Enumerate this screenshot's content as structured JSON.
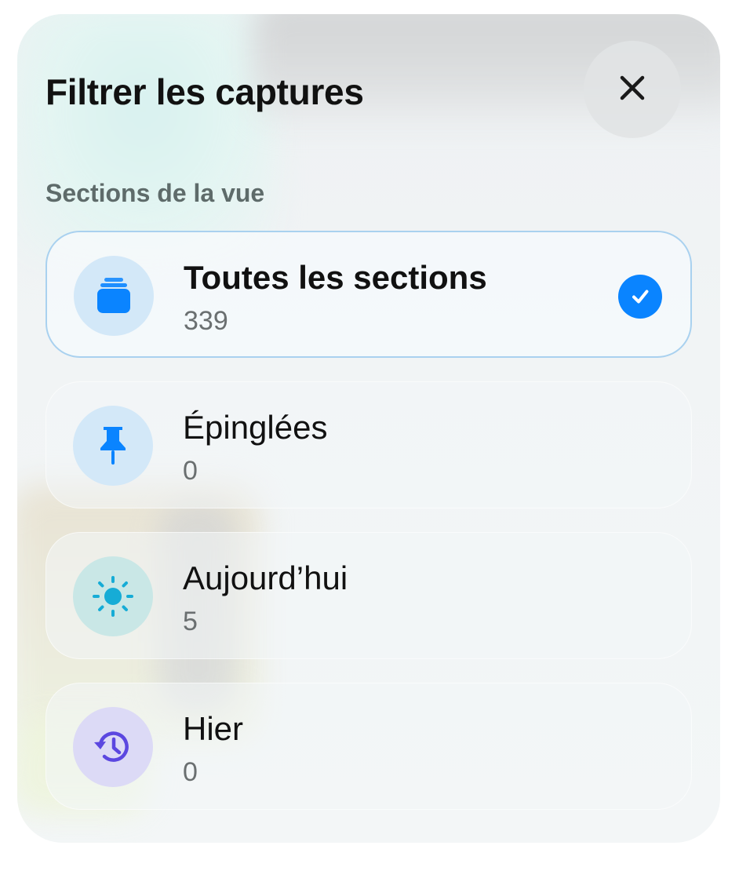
{
  "header": {
    "title": "Filtrer les captures",
    "close_icon": "close-icon"
  },
  "section_heading": "Sections de la vue",
  "items": [
    {
      "label": "Toutes les sections",
      "count": "339",
      "icon": "stack-icon",
      "selected": true,
      "icon_bg": "#d3e8f8",
      "icon_color": "#0a84ff"
    },
    {
      "label": "Épinglées",
      "count": "0",
      "icon": "pin-icon",
      "selected": false,
      "icon_bg": "#d3e8f8",
      "icon_color": "#0a84ff"
    },
    {
      "label": "Aujourd’hui",
      "count": "5",
      "icon": "sun-icon",
      "selected": false,
      "icon_bg": "#c9e7e6",
      "icon_color": "#16acd6"
    },
    {
      "label": "Hier",
      "count": "0",
      "icon": "history-icon",
      "selected": false,
      "icon_bg": "#dcdaf6",
      "icon_color": "#5b47e0"
    }
  ],
  "colors": {
    "accent": "#0a84ff",
    "selected_border": "#a9d1ef"
  }
}
